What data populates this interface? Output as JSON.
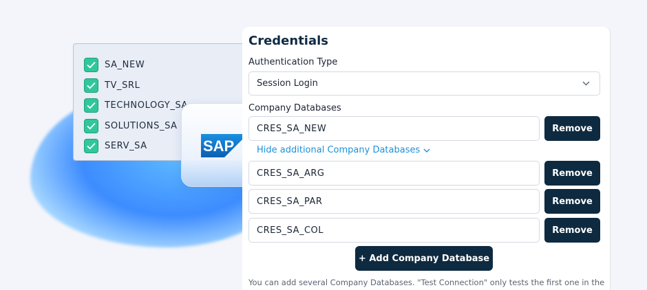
{
  "colors": {
    "accent_dark": "#0e2a40",
    "link": "#1e90d8",
    "check": "#2fc79b"
  },
  "db_list": {
    "items": [
      {
        "label": "SA_NEW",
        "checked": true
      },
      {
        "label": "TV_SRL",
        "checked": true
      },
      {
        "label": "TECHNOLOGY_SA",
        "checked": true
      },
      {
        "label": "SOLUTIONS_SA",
        "checked": true
      },
      {
        "label": "SERV_SA",
        "checked": true
      }
    ]
  },
  "sap_card": {
    "logo_text": "SAP",
    "icon": "sap-logo-icon"
  },
  "credentials": {
    "title": "Credentials",
    "auth_label": "Authentication Type",
    "auth_value": "Session Login",
    "company_db_label": "Company Databases",
    "primary_db": "CRES_SA_NEW",
    "toggle_label": "Hide additional Company Databases",
    "additional_dbs": [
      "CRES_SA_ARG",
      "CRES_SA_PAR",
      "CRES_SA_COL"
    ],
    "remove_label": "Remove",
    "add_label": "+ Add Company Database",
    "help_text": "You can add several Company Databases. \"Test Connection\" only tests the first one in the list;"
  }
}
